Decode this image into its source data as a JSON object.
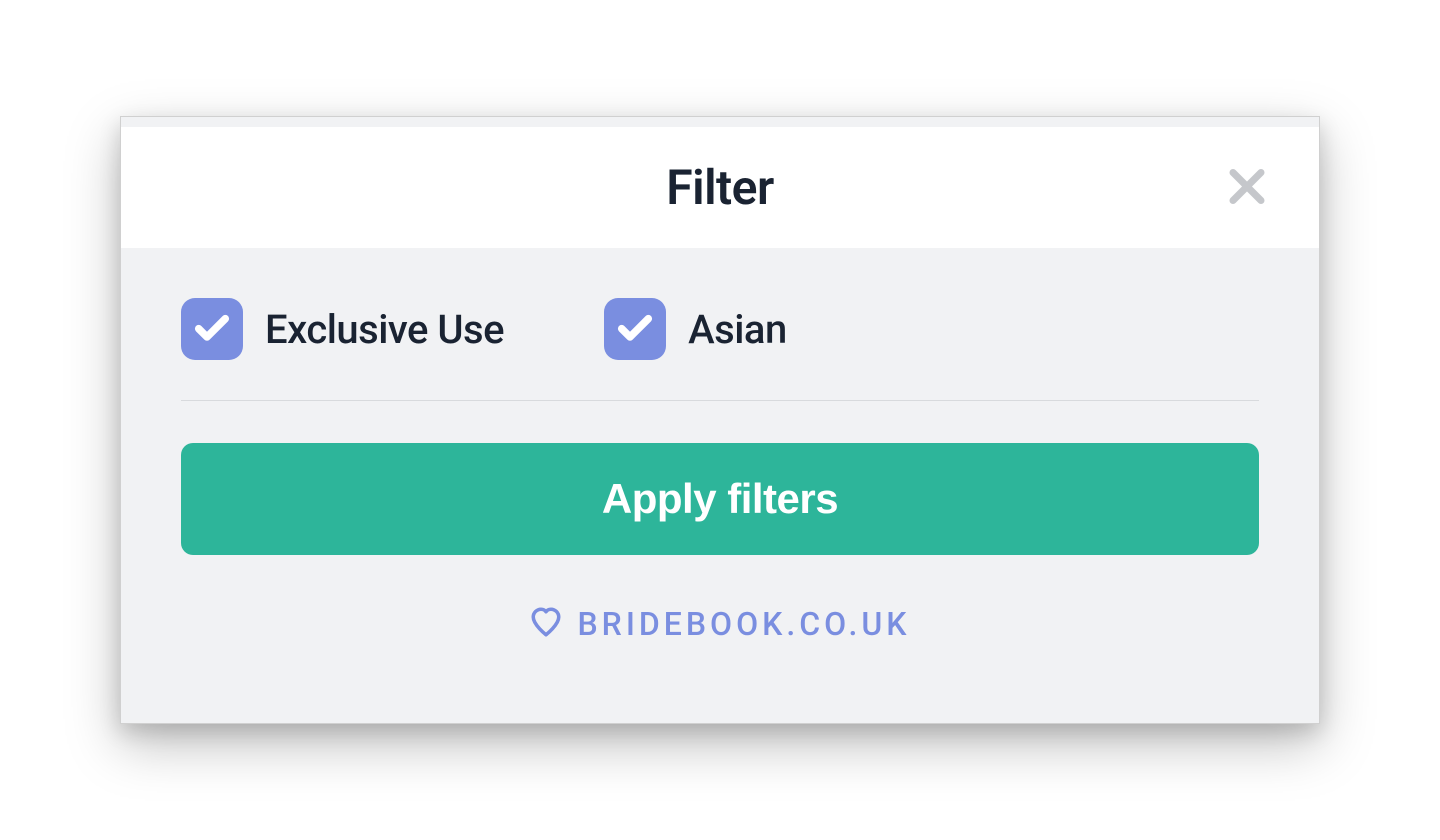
{
  "modal": {
    "title": "Filter",
    "filters": [
      {
        "label": "Exclusive Use",
        "checked": true
      },
      {
        "label": "Asian",
        "checked": true
      }
    ],
    "apply_label": "Apply filters"
  },
  "footer": {
    "brand": "BRIDEBOOK.CO.UK"
  },
  "colors": {
    "accent": "#7a8ee0",
    "primary_action": "#2db59a",
    "text_dark": "#1a2332",
    "body_bg": "#f1f2f4"
  }
}
